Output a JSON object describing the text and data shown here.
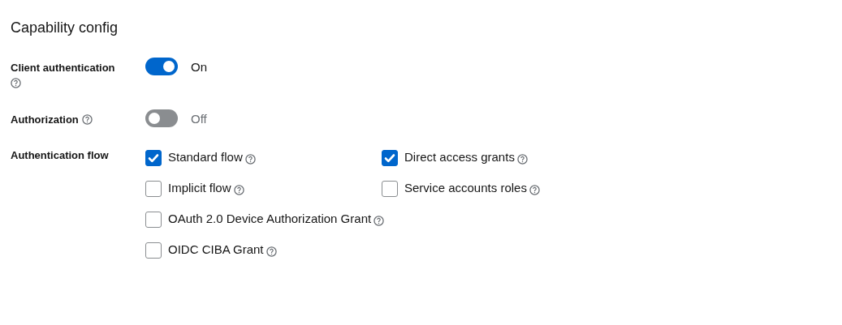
{
  "title": "Capability config",
  "switches": [
    {
      "label": "Client authentication",
      "on": true,
      "state_text": "On"
    },
    {
      "label": "Authorization",
      "on": false,
      "state_text": "Off"
    }
  ],
  "authentication_flow": {
    "label": "Authentication flow",
    "options": [
      {
        "label": "Standard flow",
        "checked": true
      },
      {
        "label": "Direct access grants",
        "checked": true
      },
      {
        "label": "Implicit flow",
        "checked": false
      },
      {
        "label": "Service accounts roles",
        "checked": false
      },
      {
        "label": "OAuth 2.0 Device Authorization Grant",
        "checked": false
      },
      {
        "label": "OIDC CIBA Grant",
        "checked": false
      }
    ]
  }
}
